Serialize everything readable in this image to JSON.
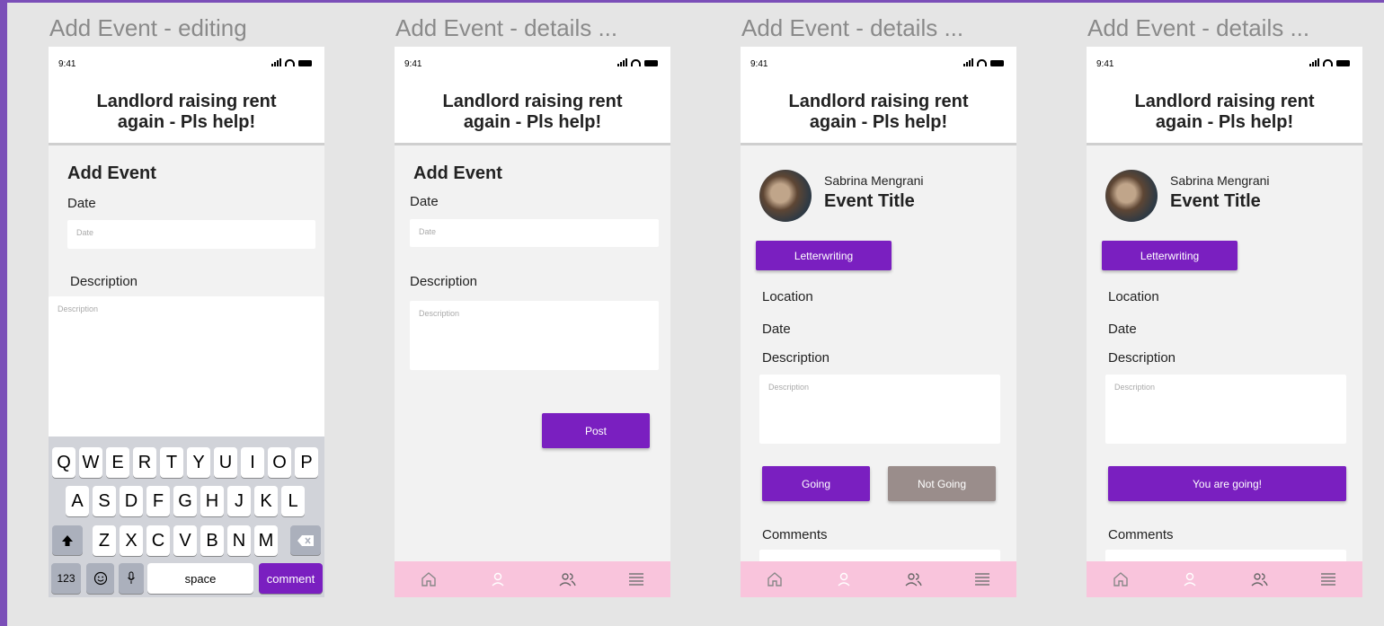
{
  "frames": [
    {
      "label": "Add Event - editing"
    },
    {
      "label": "Add Event - details ..."
    },
    {
      "label": "Add Event - details ..."
    },
    {
      "label": "Add Event - details ..."
    }
  ],
  "status": {
    "time": "9:41"
  },
  "post": {
    "title_line1": "Landlord raising rent",
    "title_line2": "again - Pls help!"
  },
  "form": {
    "heading": "Add Event",
    "date_label": "Date",
    "date_placeholder": "Date",
    "description_label": "Description",
    "description_placeholder": "Description",
    "post_button": "Post"
  },
  "event": {
    "author": "Sabrina Mengrani",
    "title": "Event Title",
    "tag": "Letterwriting",
    "location_label": "Location",
    "date_label": "Date",
    "description_label": "Description",
    "description_placeholder": "Description",
    "going_button": "Going",
    "not_going_button": "Not Going",
    "you_are_going": "You are going!",
    "comments_label": "Comments"
  },
  "keyboard": {
    "row1": [
      "Q",
      "W",
      "E",
      "R",
      "T",
      "Y",
      "U",
      "I",
      "O",
      "P"
    ],
    "row2": [
      "A",
      "S",
      "D",
      "F",
      "G",
      "H",
      "J",
      "K",
      "L"
    ],
    "row3": [
      "Z",
      "X",
      "C",
      "V",
      "B",
      "N",
      "M"
    ],
    "num_key": "123",
    "space_key": "space",
    "return_key": "comment"
  },
  "nav_icons": [
    "home-icon",
    "profile-icon",
    "group-icon",
    "menu-icon"
  ],
  "colors": {
    "accent": "#7a1fc0",
    "nav_bg": "#f9c4dc",
    "grey_button": "#9a8d8b"
  }
}
